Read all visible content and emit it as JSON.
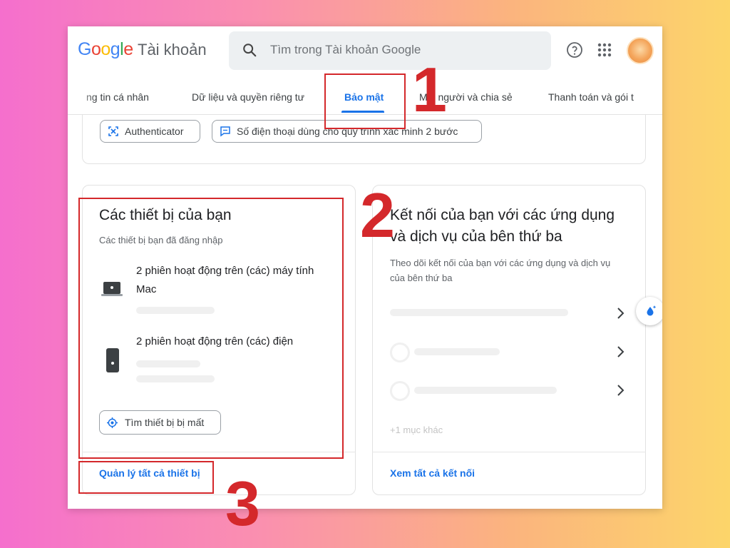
{
  "header": {
    "logo_letters": [
      "G",
      "o",
      "o",
      "g",
      "l",
      "e"
    ],
    "logo_suffix": "Tài khoản",
    "search_placeholder": "Tìm trong Tài khoản Google"
  },
  "tabs": [
    {
      "label": "ng tin cá nhân",
      "active": false
    },
    {
      "label": "Dữ liệu và quyền riêng tư",
      "active": false
    },
    {
      "label": "Bảo mật",
      "active": true
    },
    {
      "label": "Mọi người và chia sẻ",
      "active": false
    },
    {
      "label": "Thanh toán và gói t",
      "active": false
    }
  ],
  "chips": [
    {
      "label": "Authenticator",
      "icon": "authenticator-icon"
    },
    {
      "label": "Số điện thoại dùng cho quy trình xác minh 2 bước",
      "icon": "sms-icon"
    }
  ],
  "devices": {
    "title": "Các thiết bị của bạn",
    "subtitle": "Các thiết bị bạn đã đăng nhập",
    "items": [
      {
        "text": "2 phiên hoạt động trên (các) máy tính Mac",
        "icon": "laptop-icon"
      },
      {
        "text": "2 phiên hoạt động trên (các) điện",
        "icon": "phone-icon"
      }
    ],
    "find_button": "Tìm thiết bị bị mất",
    "manage_link": "Quản lý tất cả thiết bị"
  },
  "connections": {
    "title_line1": "Kết nối của bạn với các ứng dụng",
    "title_line2": "và dịch vụ của bên thứ ba",
    "subtitle": "Theo dõi kết nối của bạn với các ứng dụng và dịch vụ của bên thứ ba",
    "more": "+1 mục khác",
    "view_all_link": "Xem tất cả kết nối"
  },
  "annotations": [
    "1",
    "2",
    "3"
  ],
  "colors": {
    "accent": "#1a73e8",
    "annotation_red": "#d4282b"
  }
}
